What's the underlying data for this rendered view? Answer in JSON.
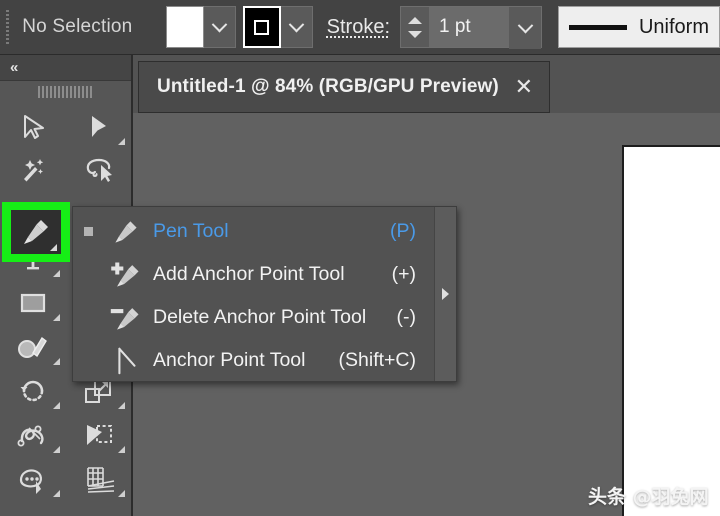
{
  "control_bar": {
    "selection_status": "No Selection",
    "fill_swatch": {
      "name": "fill-swatch",
      "color": "#ffffff"
    },
    "stroke_swatch": {
      "name": "stroke-swatch",
      "color": "#000000"
    },
    "stroke_label": "Stroke:",
    "stroke_weight": "1 pt",
    "profile_label": "Uniform",
    "dropdown_icon": "chevron-down-icon",
    "stepper_up_icon": "triangle-up-icon",
    "stepper_down_icon": "triangle-down-icon"
  },
  "tool_panel": {
    "collapse_icon": "double-chevron-left-icon",
    "collapse_label": "«",
    "grip_icon": "drag-grip-icon",
    "tools": [
      {
        "name": "selection-tool",
        "icon": "arrow-cursor-icon",
        "has_flyout": false
      },
      {
        "name": "direct-selection-tool",
        "icon": "white-arrow-cursor-icon",
        "has_flyout": true
      },
      {
        "name": "magic-wand-tool",
        "icon": "magic-wand-icon",
        "has_flyout": false
      },
      {
        "name": "lasso-tool",
        "icon": "lasso-icon",
        "has_flyout": false
      },
      {
        "name": "pen-tool",
        "icon": "pen-nib-icon",
        "has_flyout": true,
        "selected": true
      },
      {
        "name": "curvature-tool",
        "icon": "curvature-icon",
        "has_flyout": false
      },
      {
        "name": "type-tool",
        "icon": "type-t-icon",
        "has_flyout": true
      },
      {
        "name": "line-segment-tool",
        "icon": "line-segment-icon",
        "has_flyout": true
      },
      {
        "name": "rectangle-tool",
        "icon": "rectangle-icon",
        "has_flyout": true
      },
      {
        "name": "paintbrush-tool",
        "icon": "paintbrush-icon",
        "has_flyout": true
      },
      {
        "name": "shaper-tool",
        "icon": "shaper-pencil-icon",
        "has_flyout": true
      },
      {
        "name": "blob-brush-tool",
        "icon": "blob-brush-icon",
        "has_flyout": true
      },
      {
        "name": "rotate-tool",
        "icon": "rotate-icon",
        "has_flyout": true
      },
      {
        "name": "scale-tool",
        "icon": "scale-icon",
        "has_flyout": true
      },
      {
        "name": "width-tool",
        "icon": "width-warp-icon",
        "has_flyout": true
      },
      {
        "name": "free-transform-tool",
        "icon": "free-transform-icon",
        "has_flyout": true
      },
      {
        "name": "shape-builder-tool",
        "icon": "shape-builder-icon",
        "has_flyout": true
      },
      {
        "name": "perspective-grid-tool",
        "icon": "perspective-grid-icon",
        "has_flyout": true
      }
    ]
  },
  "document_tab": {
    "title": "Untitled-1 @ 84% (RGB/GPU Preview)",
    "close_icon": "close-x-icon",
    "close_label": "✕"
  },
  "flyout_menu": {
    "tear_off_icon": "tear-off-arrow-icon",
    "items": [
      {
        "label": "Pen Tool",
        "shortcut": "(P)",
        "icon": "pen-nib-icon",
        "active": true,
        "bullet": true
      },
      {
        "label": "Add Anchor Point Tool",
        "shortcut": "(+)",
        "icon": "pen-plus-icon",
        "active": false,
        "bullet": false
      },
      {
        "label": "Delete Anchor Point Tool",
        "shortcut": "(-)",
        "icon": "pen-minus-icon",
        "active": false,
        "bullet": false
      },
      {
        "label": "Anchor Point Tool",
        "shortcut": "(Shift+C)",
        "icon": "anchor-point-icon",
        "active": false,
        "bullet": false
      }
    ]
  },
  "canvas": {
    "artboard_color": "#ffffff",
    "background_color": "#616161"
  },
  "watermark": {
    "text": "头条 @羽兔网"
  },
  "colors": {
    "accent_blue": "#4a9ae8",
    "highlight_green": "#16ee16",
    "panel_gray": "#565656",
    "bar_gray": "#434343"
  }
}
